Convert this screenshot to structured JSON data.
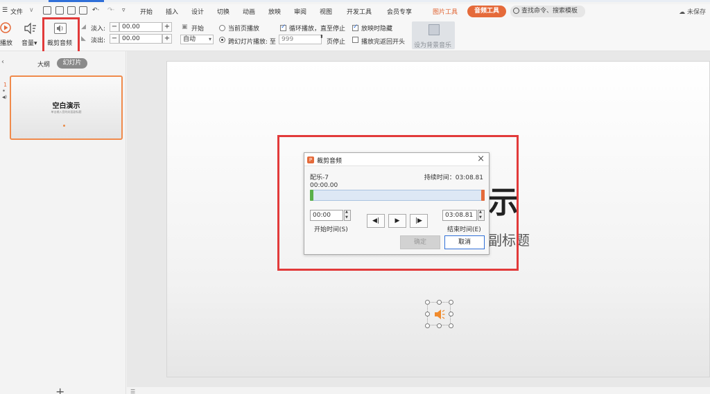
{
  "menu": {
    "file": "文件",
    "tabs": [
      "开始",
      "插入",
      "设计",
      "切换",
      "动画",
      "放映",
      "审阅",
      "视图",
      "开发工具",
      "会员专享"
    ],
    "picture_tools": "图片工具",
    "audio_tools": "音频工具",
    "search_placeholder": "查找命令、搜索模板",
    "unsaved": "未保存"
  },
  "ribbon": {
    "play": "播放",
    "volume": "音量",
    "trim_audio": "裁剪音频",
    "fade_in_label": "淡入:",
    "fade_in_value": "00.00",
    "fade_out_label": "淡出:",
    "fade_out_value": "00.00",
    "start_label": "开始",
    "start_value": "自动",
    "current_page_play": "当前页播放",
    "cross_slide_play": "跨幻灯片播放: 至",
    "cross_slide_value": "999",
    "page_stop": "页停止",
    "loop_play": "循环播放，直至停止",
    "hide_on_show": "放映时隐藏",
    "rewind_after": "播放完返回开头",
    "set_bg_music": "设为背景音乐"
  },
  "left_panel": {
    "tab_outline": "大纲",
    "tab_slides": "幻灯片",
    "slide_number": "1",
    "thumb_title": "空白演示",
    "thumb_subtitle": "单击输入您的封面副标题"
  },
  "slide": {
    "title_visible_part": "示",
    "subtitle_visible_part": "副标题"
  },
  "dialog": {
    "title": "裁剪音频",
    "track_name": "配乐-7",
    "duration_label": "持续时间：03:08.81",
    "current_time": "00:00.00",
    "start_time_value": "00:00",
    "start_time_label": "开始时间(S)",
    "end_time_value": "03:08.81",
    "end_time_label": "结束时间(E)",
    "ok": "确定",
    "cancel": "取消"
  },
  "colors": {
    "accent_orange": "#e56a3a",
    "highlight_red": "#e23a3a",
    "blue": "#2f6fd8"
  }
}
